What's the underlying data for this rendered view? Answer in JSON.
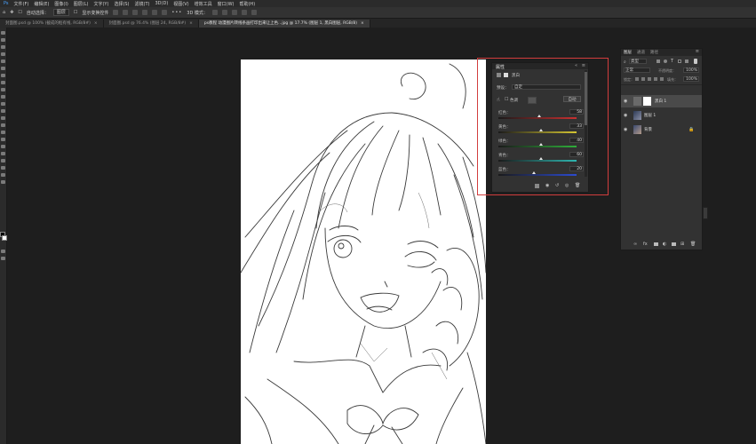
{
  "menu": [
    "文件(F)",
    "编辑(E)",
    "图像(I)",
    "图层(L)",
    "文字(Y)",
    "选择(S)",
    "滤镜(T)",
    "3D(D)",
    "视图(V)",
    "增效工具",
    "窗口(W)",
    "帮助(H)"
  ],
  "options": {
    "auto_select_label": "自动选择：",
    "auto_select_target": "图层",
    "show_transform_label": "显示变换控件",
    "three_d_mode": "3D 模式："
  },
  "tabs": [
    {
      "label": "封面图.psd @ 100% (截成的框有线, RGB/8#)",
      "active": false
    },
    {
      "label": "封面图.psd @ 76.4% (图层 24, RGB/8#)",
      "active": false
    },
    {
      "label": "ps教程 动漫图片转线条画打印出来让上色...jpg @ 17.7% (图层 1, 黑白图层, RGB/8)",
      "active": true
    }
  ],
  "properties": {
    "tab": "属性",
    "layer_type": "黑白",
    "preset_label": "预设：",
    "preset_value": "自定",
    "tint_label": "色调",
    "auto_button": "自动",
    "sliders": [
      {
        "label": "红色：",
        "value": "58",
        "pct": 0.52,
        "gradient": "linear-gradient(90deg,#1a1a1a,#c83030)"
      },
      {
        "label": "黄色：",
        "value": "33",
        "pct": 0.55,
        "gradient": "linear-gradient(90deg,#1a1a1a,#d4c532)"
      },
      {
        "label": "绿色：",
        "value": "40",
        "pct": 0.54,
        "gradient": "linear-gradient(90deg,#1a1a1a,#2fae3a)"
      },
      {
        "label": "青色：",
        "value": "60",
        "pct": 0.55,
        "gradient": "linear-gradient(90deg,#1a1a1a,#2fb6b0)"
      },
      {
        "label": "蓝色：",
        "value": "20",
        "pct": 0.45,
        "gradient": "linear-gradient(90deg,#1a1a1a,#2c4bd0)"
      }
    ]
  },
  "layers": {
    "tabs": [
      "图层",
      "通道",
      "路径"
    ],
    "filter": "类型",
    "blend_mode": "正常",
    "opacity_label": "不透明度：",
    "opacity_value": "100%",
    "lock_label": "锁定：",
    "fill_label": "填充：",
    "fill_value": "100%",
    "items": [
      {
        "name": "黑白 1",
        "selected": true
      },
      {
        "name": "图层 1",
        "selected": false
      },
      {
        "name": "背景",
        "selected": false
      }
    ]
  },
  "colors": {
    "accent_selection": "#d23d3d",
    "panel_bg": "#323232",
    "workspace_bg": "#1e1e1e"
  }
}
